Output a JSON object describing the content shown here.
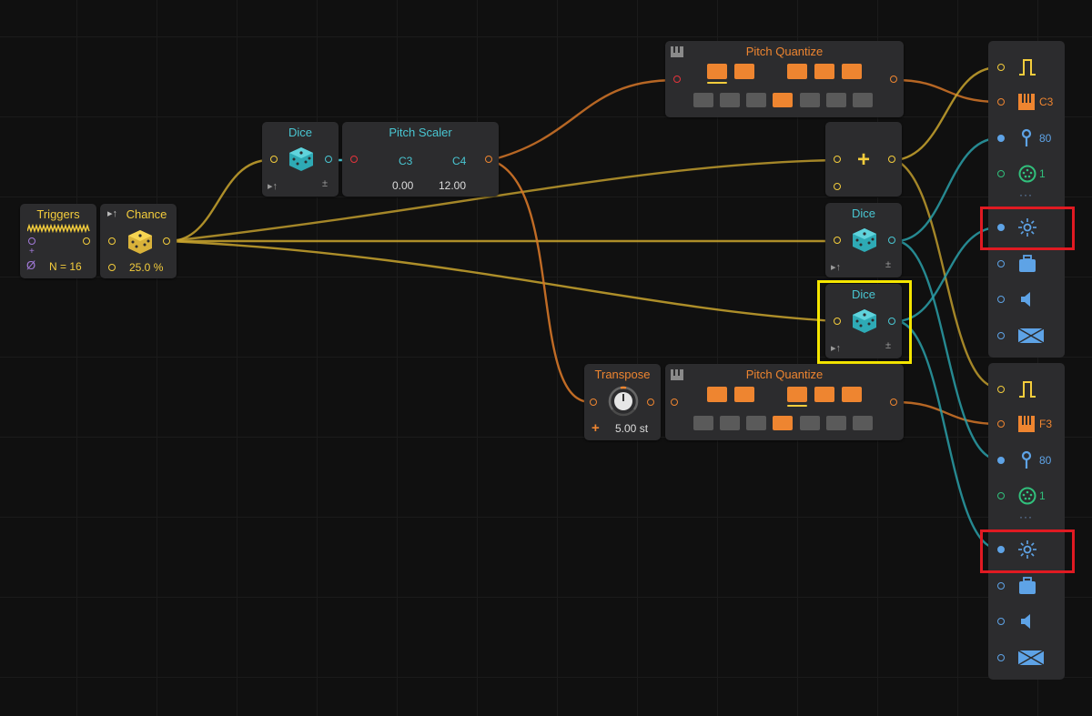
{
  "colors": {
    "background": "#101010",
    "node": "#2c2c2e",
    "yellow": "#f4cd3c",
    "cyan": "#49c6d2",
    "orange": "#ee8530",
    "red": "#e5343c",
    "blue": "#5ea3e6",
    "green": "#31c07c",
    "highlight_red": "#e01a22",
    "highlight_yellow": "#f5e600"
  },
  "triggers": {
    "title": "Triggers",
    "count": "N = 16"
  },
  "chance": {
    "title": "Chance",
    "value": "25.0 %"
  },
  "dice_top": {
    "title": "Dice"
  },
  "pitch_scaler": {
    "title": "Pitch Scaler",
    "from_note": "C3",
    "to_note": "C4",
    "from_value": "0.00",
    "to_value": "12.00"
  },
  "pitch_quantize_top": {
    "title": "Pitch Quantize"
  },
  "pitch_quantize_bottom": {
    "title": "Pitch Quantize"
  },
  "adder": {
    "symbol": "+"
  },
  "dice_mid": {
    "title": "Dice"
  },
  "dice_sel": {
    "title": "Dice"
  },
  "transpose": {
    "title": "Transpose",
    "value": "5.00 st",
    "plus": "+"
  },
  "dice_bottom_symbol": "±",
  "voice1": {
    "note": "C3",
    "velocity": "80",
    "channel": "1",
    "more": "···"
  },
  "voice2": {
    "note": "F3",
    "velocity": "80",
    "channel": "1",
    "more": "···"
  },
  "icons": [
    "gate-icon",
    "keyboard-icon",
    "velocity-icon",
    "channel-icon",
    "brightness-icon",
    "timbre-icon",
    "volume-icon",
    "pan-icon"
  ]
}
